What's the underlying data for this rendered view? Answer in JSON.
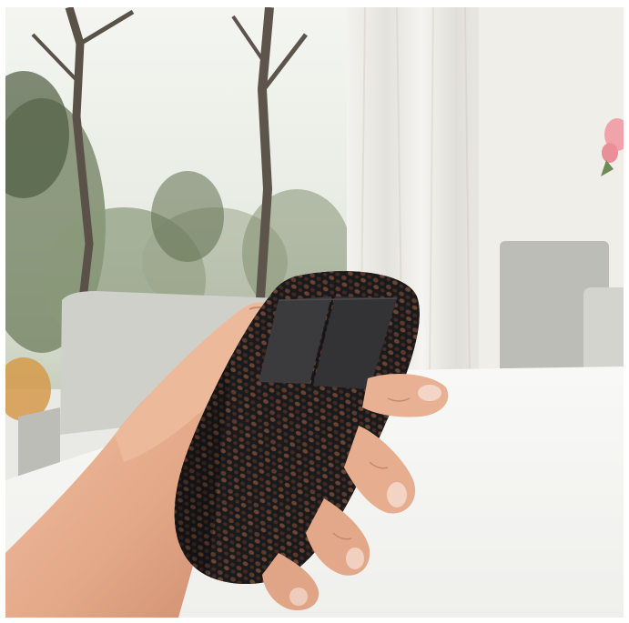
{
  "photo": {
    "subject": "hand-holding-voronoi-mouse",
    "colors": {
      "window_sky": "#eef1ea",
      "foliage_dark": "#4b5a3f",
      "foliage_mid": "#7e8d6b",
      "curtain": "#ecebe6",
      "wall": "#efeee9",
      "table": "#f6f6f3",
      "chair": "#c9c9c4",
      "skin": "#e9b698",
      "skin_shadow": "#cf9276",
      "mouse_body": "#1b1b1d",
      "mouse_buttons": "#3a3a3c",
      "flower": "#f2a0a8"
    }
  }
}
